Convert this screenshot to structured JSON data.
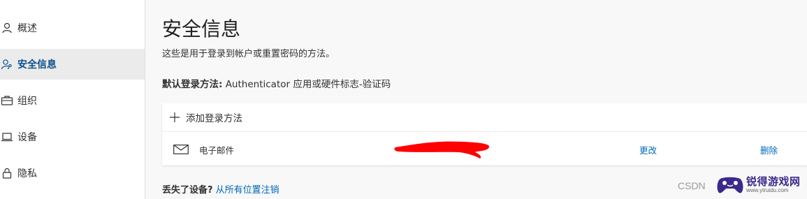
{
  "sidebar": {
    "items": [
      {
        "label": "概述",
        "icon": "person-icon",
        "active": false
      },
      {
        "label": "安全信息",
        "icon": "person-key-icon",
        "active": true
      },
      {
        "label": "组织",
        "icon": "briefcase-icon",
        "active": false
      },
      {
        "label": "设备",
        "icon": "laptop-icon",
        "active": false
      },
      {
        "label": "隐私",
        "icon": "lock-icon",
        "active": false
      }
    ]
  },
  "main": {
    "title": "安全信息",
    "subtitle": "这些是用于登录到帐户或重置密码的方法。",
    "default_method_label": "默认登录方法:",
    "default_method_value": " Authenticator 应用或硬件标志-验证码",
    "add_method_label": "添加登录方法",
    "methods": [
      {
        "name": "电子邮件",
        "icon": "mail-icon",
        "change_label": "更改",
        "delete_label": "删除"
      }
    ],
    "lost_device_label": "丢失了设备?",
    "lost_device_link": " 从所有位置注销"
  },
  "watermarks": {
    "csdn": "CSDN",
    "brand_name": "锐得游戏网",
    "brand_url": "www.ytruidu.com"
  },
  "colors": {
    "accent": "#0067b8",
    "active_nav_text": "#0b4f8a",
    "active_nav_bg": "#ebebeb",
    "redaction": "#ff0000"
  }
}
